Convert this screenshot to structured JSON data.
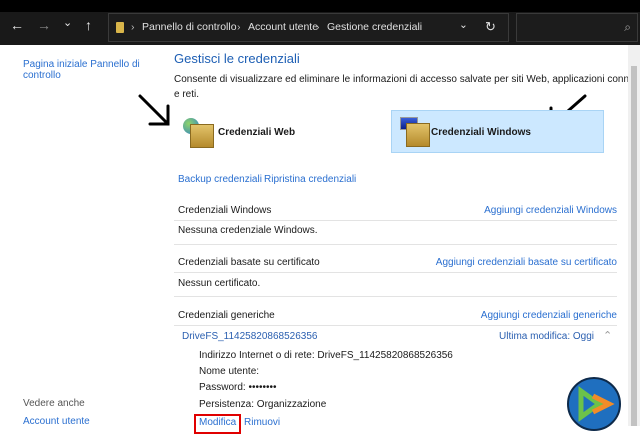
{
  "nav": {
    "back": "←",
    "forward": "→",
    "recent": "⌄",
    "up": "↑",
    "refresh": "↻",
    "dropdown": "⌄",
    "search_icon": "⌕"
  },
  "breadcrumb": [
    "Pannello di controllo",
    "Account utente",
    "Gestione credenziali"
  ],
  "sidebar": {
    "home_link": "Pagina iniziale Pannello di controllo",
    "home_line1": "Pagina iniziale Pannello di",
    "home_line2": "controllo",
    "see_also": "Vedere anche",
    "account_link": "Account utente"
  },
  "main": {
    "title": "Gestisci le credenziali",
    "description_line1": "Consente di visualizzare ed eliminare le informazioni di accesso salvate per siti Web, applicazioni connesse",
    "description_line2": "e reti.",
    "web_tile": "Credenziali Web",
    "windows_tile": "Credenziali Windows",
    "backup": "Backup credenziali",
    "restore": "Ripristina credenziali",
    "sections": [
      {
        "title": "Credenziali Windows",
        "add": "Aggiungi credenziali Windows",
        "empty": "Nessuna credenziale Windows."
      },
      {
        "title": "Credenziali basate su certificato",
        "add": "Aggiungi credenziali basate su certificato",
        "empty": "Nessun certificato."
      },
      {
        "title": "Credenziali generiche",
        "add": "Aggiungi credenziali generiche"
      }
    ],
    "entry": {
      "name": "DriveFS_11425820868526356",
      "modified": "Ultima modifica:  Oggi",
      "address": "Indirizzo Internet o di rete:  DriveFS_11425820868526356",
      "user": "Nome utente:",
      "password": "Password:  ••••••••",
      "persistence": "Persistenza:  Organizzazione",
      "edit": "Modifica",
      "remove": "Rimuovi"
    }
  },
  "colors": {
    "link": "#2a6fd0",
    "selected_tile": "#cce8ff",
    "highlight_box": "#e00000"
  }
}
